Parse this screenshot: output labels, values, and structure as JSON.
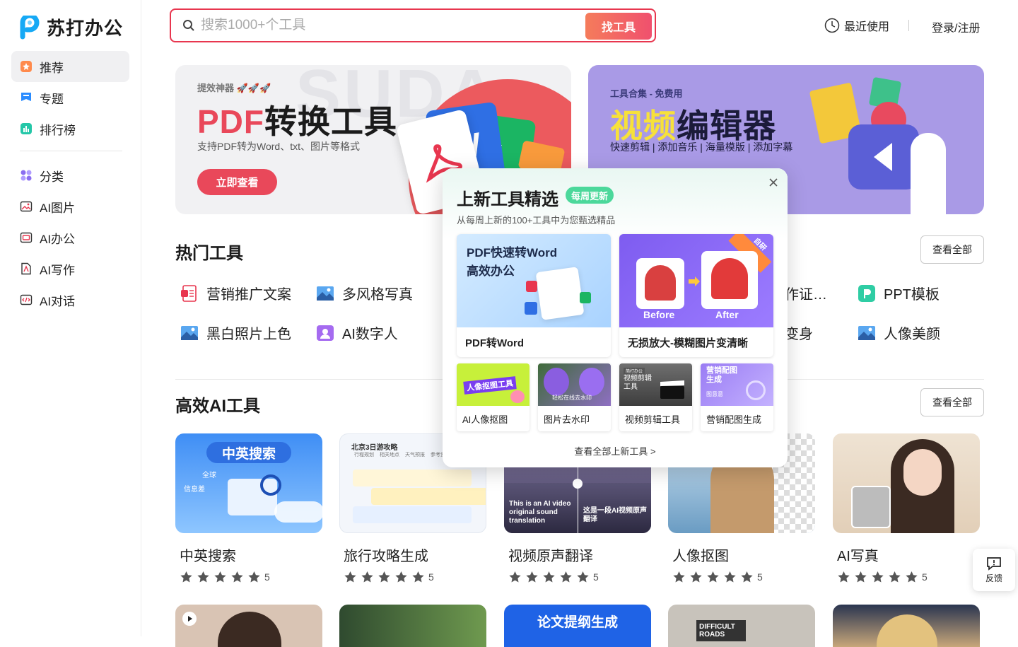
{
  "brand": {
    "name": "苏打办公"
  },
  "sidebar": {
    "items": [
      {
        "label": "推荐",
        "icon": "recommend-icon",
        "active": true
      },
      {
        "label": "专题",
        "icon": "topic-icon"
      },
      {
        "label": "排行榜",
        "icon": "ranking-icon"
      },
      {
        "label": "分类",
        "icon": "category-icon"
      },
      {
        "label": "AI图片",
        "icon": "ai-image-icon"
      },
      {
        "label": "AI办公",
        "icon": "ai-office-icon"
      },
      {
        "label": "AI写作",
        "icon": "ai-writing-icon"
      },
      {
        "label": "AI对话",
        "icon": "ai-chat-icon"
      }
    ]
  },
  "header": {
    "search_placeholder": "搜索1000+个工具",
    "search_button": "找工具",
    "recent": "最近使用",
    "login": "登录/注册"
  },
  "banners": [
    {
      "tag": "提效神器 🚀🚀🚀",
      "title_accent": "PDF",
      "title_rest": "转换工具",
      "subtitle": "支持PDF转为Word、txt、图片等格式",
      "button": "立即查看",
      "bg_text": "SUDA"
    },
    {
      "tag": "工具合集 - 免费用",
      "title_accent": "视频",
      "title_rest": "编辑器",
      "subtitle": "快速剪辑 | 添加音乐 | 海量模版 | 添加字幕"
    }
  ],
  "hot_tools": {
    "title": "热门工具",
    "see_all": "查看全部",
    "items": [
      {
        "label": "营销推广文案",
        "icon": "document-red-icon"
      },
      {
        "label": "多风格写真",
        "icon": "image-icon"
      },
      {
        "label": "作证…",
        "icon": ""
      },
      {
        "label": "PPT模板",
        "icon": "ppt-icon"
      },
      {
        "label": "黑白照片上色",
        "icon": "image-icon"
      },
      {
        "label": "AI数字人",
        "icon": "digital-human-icon"
      },
      {
        "label": "变身",
        "icon": ""
      },
      {
        "label": "人像美颜",
        "icon": "image-icon"
      }
    ]
  },
  "ai_tools": {
    "title": "高效AI工具",
    "see_all": "查看全部",
    "cards": [
      {
        "name": "中英搜索",
        "rating": "5",
        "img_title": "中英搜索",
        "img_tags": [
          "全球",
          "信息差"
        ]
      },
      {
        "name": "旅行攻略生成",
        "rating": "5",
        "img_title": "北京3日游攻略",
        "img_tabs": [
          "行程规划",
          "相关地点",
          "天气预报",
          "参考资料"
        ]
      },
      {
        "name": "视频原声翻译",
        "rating": "5",
        "img_left": "This is an AI video original sound translation",
        "img_right": "这是一段AI视频原声翻译"
      },
      {
        "name": "人像抠图",
        "rating": "5"
      },
      {
        "name": "AI写真",
        "rating": "5"
      }
    ],
    "bottom_cards": [
      {
        "label": ""
      },
      {
        "label": ""
      },
      {
        "label": "论文提纲生成"
      },
      {
        "label": "DIFFICULT ROADS"
      },
      {
        "label": ""
      }
    ]
  },
  "popup": {
    "title": "上新工具精选",
    "badge": "每周更新",
    "subtitle": "从每周上新的100+工具中为您甄选精品",
    "big": [
      {
        "label": "PDF转Word",
        "img_title": "PDF快速转Word\n高效办公"
      },
      {
        "label": "无损放大-模糊图片变清晰",
        "img_before": "Before",
        "img_after": "After",
        "ribbon": "自研"
      }
    ],
    "small": [
      {
        "label": "AI人像抠图",
        "img_text": "人像抠图工具"
      },
      {
        "label": "图片去水印",
        "img_text": "轻松在线去水印"
      },
      {
        "label": "视频剪辑工具",
        "img_text": "视频剪辑工具",
        "img_tag": "简打办公"
      },
      {
        "label": "营销配图生成",
        "img_text": "营销配图生成",
        "img_tag": "图意意"
      }
    ],
    "more": "查看全部上新工具 >"
  },
  "feedback": {
    "label": "反馈"
  },
  "colors": {
    "accent": "#e8364f",
    "brand_blue": "#1e9bff",
    "popup_badge": "#4cd89b"
  }
}
